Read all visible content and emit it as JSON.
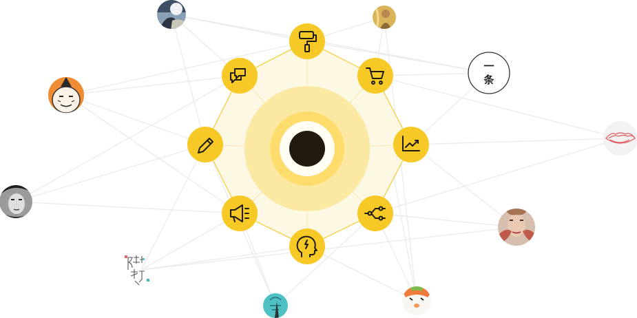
{
  "colors": {
    "accent": "#f7c926",
    "octagon_fill": "#fdf8e4",
    "octagon_stroke": "#f4cf43",
    "halo_outer": "#fbe8a2",
    "halo_mid": "#fddc6d",
    "halo_inner": "#fbd23a",
    "core_ring": "#fffdf4",
    "core": "#221a0c",
    "link": "#ececec"
  },
  "hub": {
    "nodes": [
      {
        "id": "paint-roller",
        "icon": "paint-roller-icon"
      },
      {
        "id": "shopping-cart",
        "icon": "shopping-cart-icon"
      },
      {
        "id": "trend-chart",
        "icon": "trend-chart-icon"
      },
      {
        "id": "workflow",
        "icon": "workflow-icon"
      },
      {
        "id": "brain",
        "icon": "brain-head-icon"
      },
      {
        "id": "megaphone",
        "icon": "megaphone-icon"
      },
      {
        "id": "pencil",
        "icon": "pencil-icon"
      },
      {
        "id": "chat",
        "icon": "chat-bubbles-icon"
      }
    ]
  },
  "partners": [
    {
      "id": "moon-photo",
      "icon": "moon-photo-avatar"
    },
    {
      "id": "girl-photo",
      "icon": "portrait-avatar"
    },
    {
      "id": "yitiao",
      "icon": "yitiao-logo",
      "text_top": "一",
      "text_bottom": "条"
    },
    {
      "id": "lips",
      "icon": "lips-logo"
    },
    {
      "id": "colorful-face",
      "icon": "painted-face-avatar"
    },
    {
      "id": "pear-mascot",
      "icon": "mascot-avatar"
    },
    {
      "id": "teal-art",
      "icon": "teal-artwork-avatar"
    },
    {
      "id": "calligraphy",
      "icon": "calligraphy-logo"
    },
    {
      "id": "audrey",
      "icon": "audrey-portrait-avatar"
    },
    {
      "id": "cartoon-man",
      "icon": "cartoon-man-avatar"
    }
  ]
}
